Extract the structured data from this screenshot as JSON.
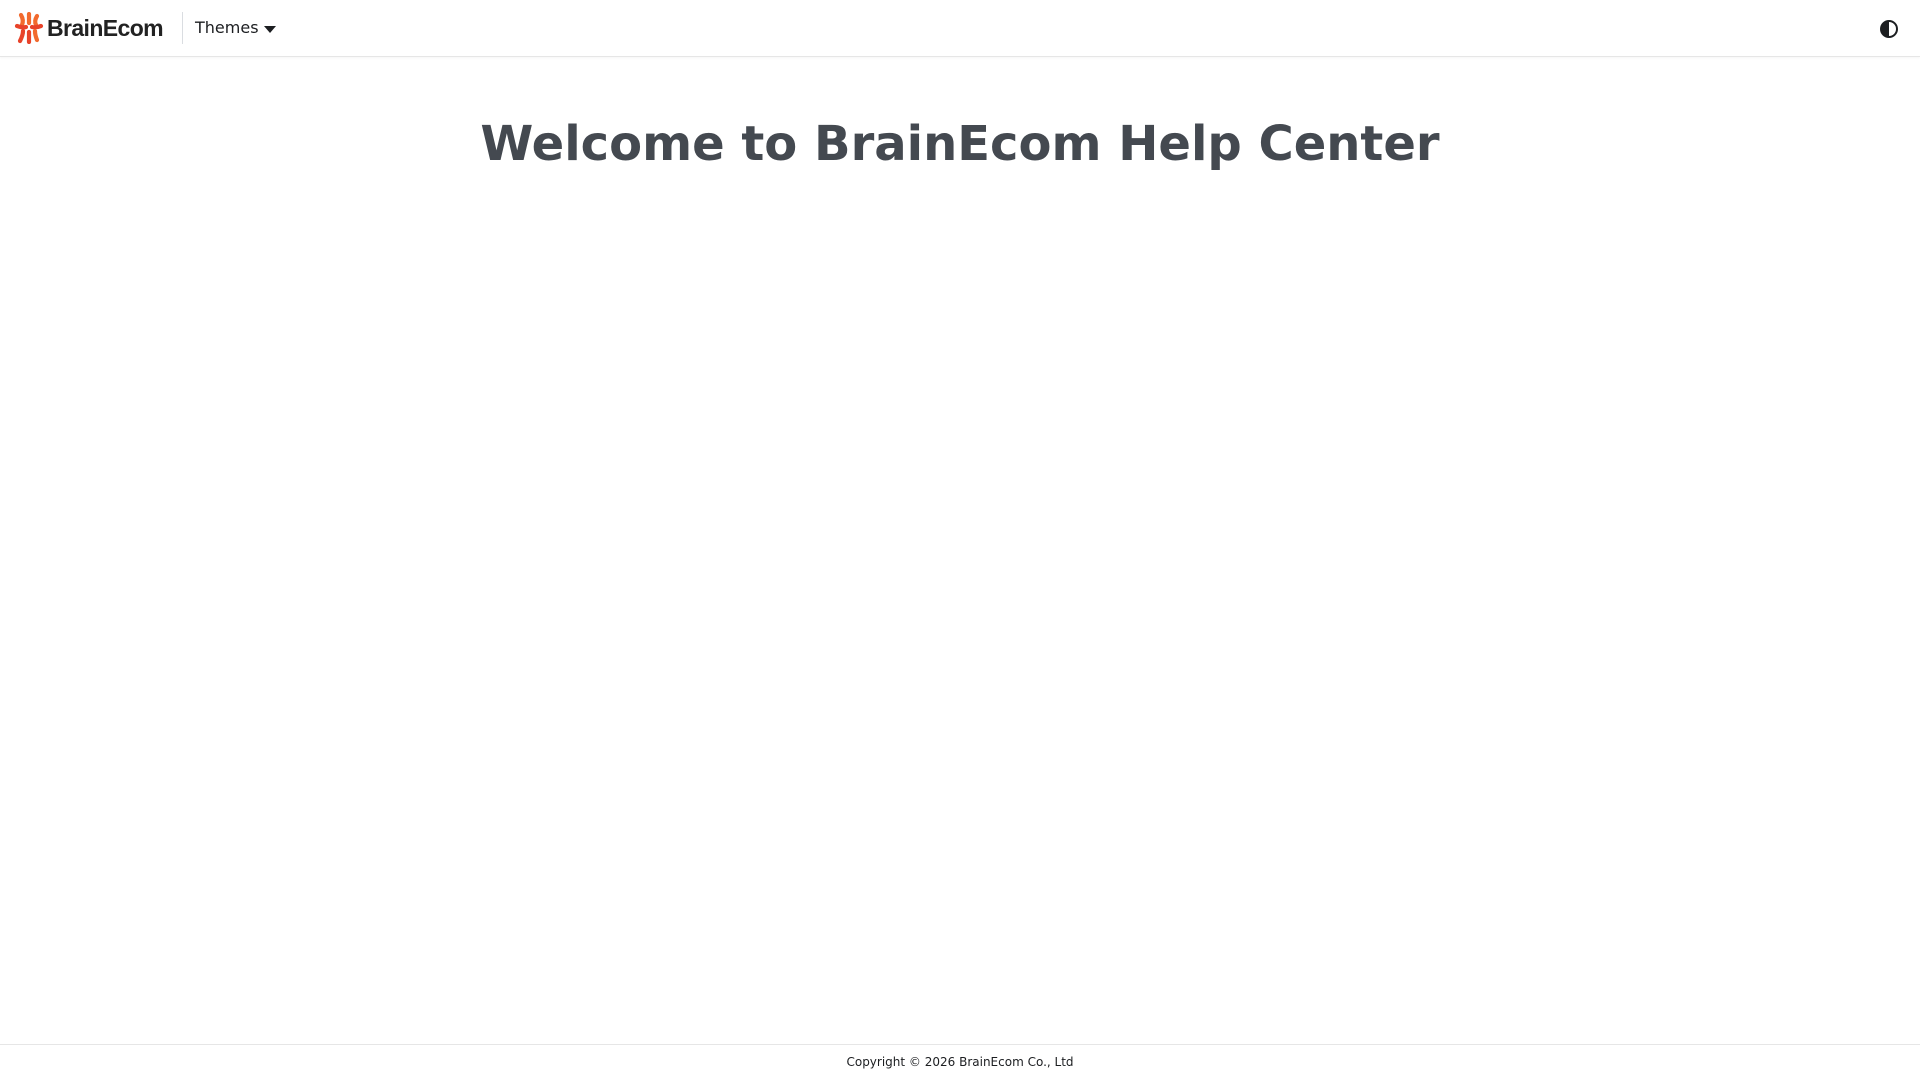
{
  "navbar": {
    "brand_text": "BrainEcom",
    "brand_icon": "brainecom-logo-icon",
    "themes_label": "Themes",
    "dropdown_icon": "caret-down-icon",
    "theme_toggle_icon": "contrast-icon"
  },
  "main": {
    "title": "Welcome to BrainEcom Help Center"
  },
  "footer": {
    "copyright": "Copyright © 2026 BrainEcom Co., Ltd"
  },
  "colors": {
    "brand_orange": "#f26a2e",
    "brand_red": "#e8432a",
    "title_gray": "#444950",
    "border": "#e6e6e6"
  }
}
